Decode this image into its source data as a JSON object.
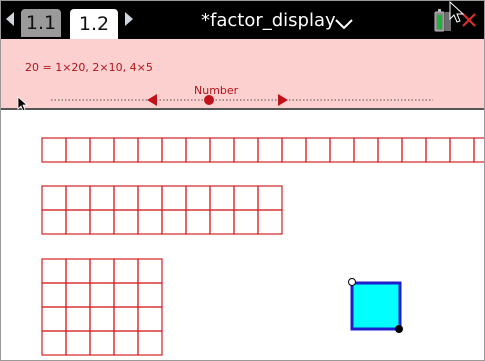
{
  "tabs": [
    {
      "label": "1.1",
      "active": false
    },
    {
      "label": "1.2",
      "active": true
    }
  ],
  "document": {
    "title": "*factor_display"
  },
  "top_pane": {
    "factor_text": "20 = 1×20, 2×10, 4×5",
    "slider_label": "Number"
  },
  "icons": {
    "prev": "left-arrow-icon",
    "next": "right-arrow-icon",
    "menu": "chevron-down-icon",
    "battery": "battery-icon",
    "close": "close-icon",
    "pointer": "mouse-pointer-icon"
  },
  "grids": [
    {
      "rows": 1,
      "cols": 20
    },
    {
      "rows": 2,
      "cols": 10
    },
    {
      "rows": 4,
      "cols": 5
    }
  ],
  "colors": {
    "grid_line": "#d42020",
    "pane_bg": "#fdd0d0",
    "accent_text": "#b0141a",
    "square_fill": "#00ffff",
    "square_border": "#1d1dcc"
  }
}
